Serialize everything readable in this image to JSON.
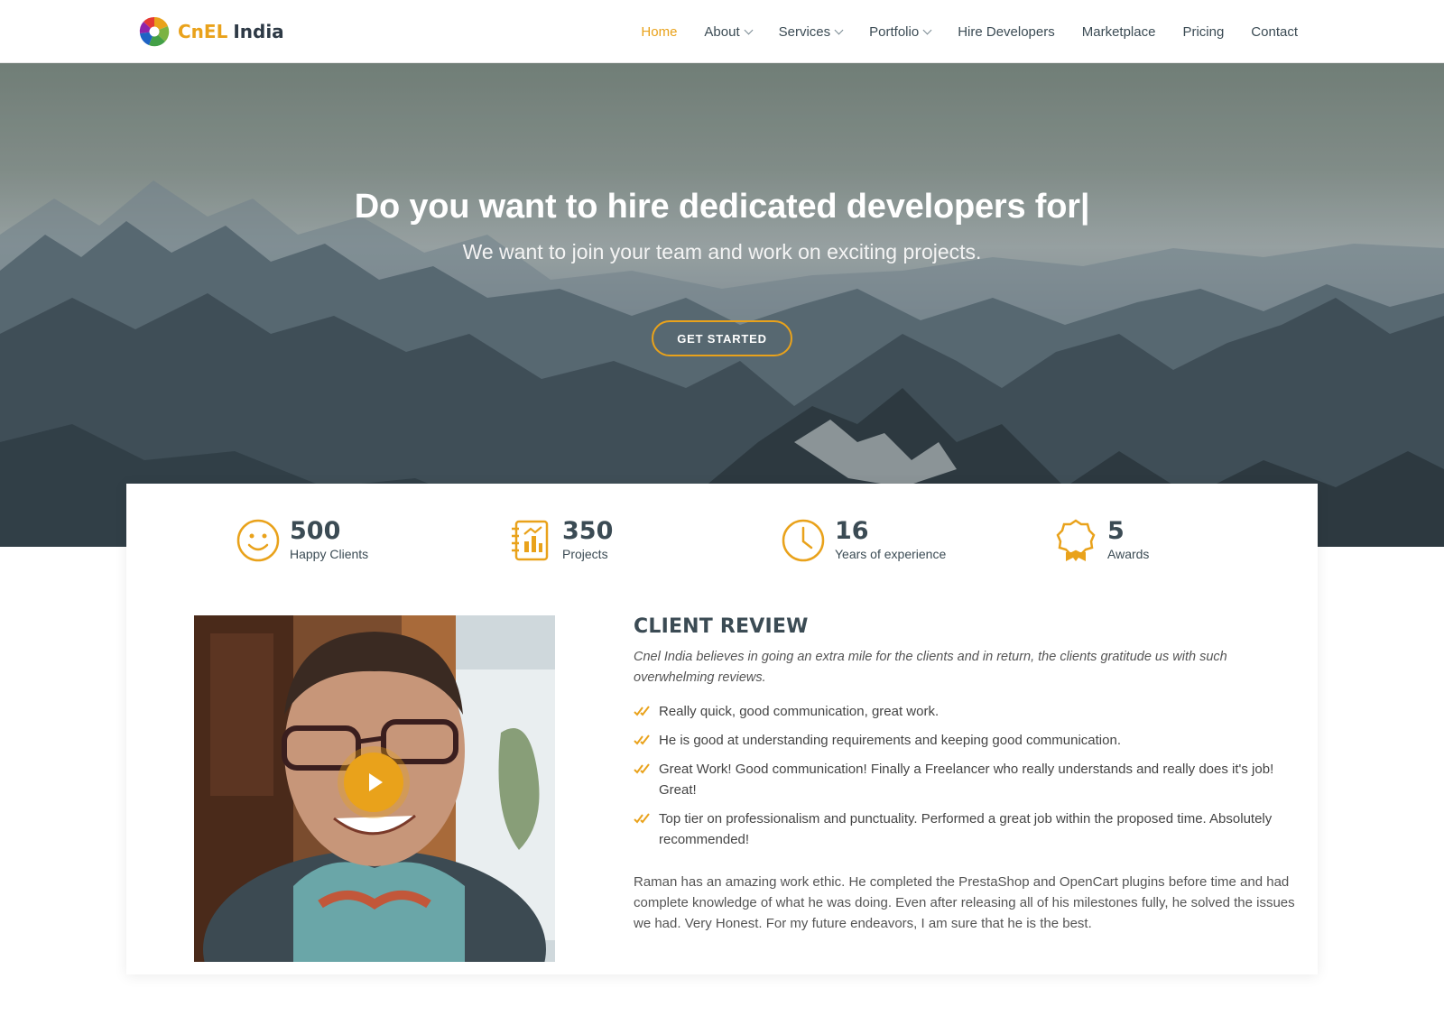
{
  "brand": {
    "name_part1": "CnEL",
    "name_part2": "India",
    "accent_color": "#e9a21b",
    "logo_icon": "swirl-logo-icon"
  },
  "nav": {
    "items": [
      {
        "label": "Home",
        "active": true,
        "dropdown": false
      },
      {
        "label": "About",
        "active": false,
        "dropdown": true
      },
      {
        "label": "Services",
        "active": false,
        "dropdown": true
      },
      {
        "label": "Portfolio",
        "active": false,
        "dropdown": true
      },
      {
        "label": "Hire Developers",
        "active": false,
        "dropdown": false
      },
      {
        "label": "Marketplace",
        "active": false,
        "dropdown": false
      },
      {
        "label": "Pricing",
        "active": false,
        "dropdown": false
      },
      {
        "label": "Contact",
        "active": false,
        "dropdown": false
      }
    ]
  },
  "hero": {
    "title": "Do you want to hire dedicated developers for|",
    "subtitle": "We want to join your team and work on exciting projects.",
    "cta_label": "GET STARTED"
  },
  "stats": [
    {
      "value": "500",
      "label": "Happy Clients",
      "icon": "smiley-icon"
    },
    {
      "value": "350",
      "label": "Projects",
      "icon": "notebook-chart-icon"
    },
    {
      "value": "16",
      "label": "Years of experience",
      "icon": "clock-icon"
    },
    {
      "value": "5",
      "label": "Awards",
      "icon": "award-badge-icon"
    }
  ],
  "review": {
    "title": "CLIENT REVIEW",
    "intro": "Cnel India believes in going an extra mile for the clients and in return, the clients gratitude us with such overwhelming reviews.",
    "items": [
      "Really quick, good communication, great work.",
      "He is good at understanding requirements and keeping good communication.",
      "Great Work! Good communication! Finally a Freelancer who really understands and really does it's job! Great!",
      "Top tier on professionalism and punctuality. Performed a great job within the proposed time. Absolutely recommended!"
    ],
    "testimonial": "Raman has an amazing work ethic. He completed the PrestaShop and OpenCart plugins before time and had complete knowledge of what he was doing. Even after releasing all of his milestones fully, he solved the issues we had. Very Honest. For my future endeavors, I am sure that he is the best."
  }
}
